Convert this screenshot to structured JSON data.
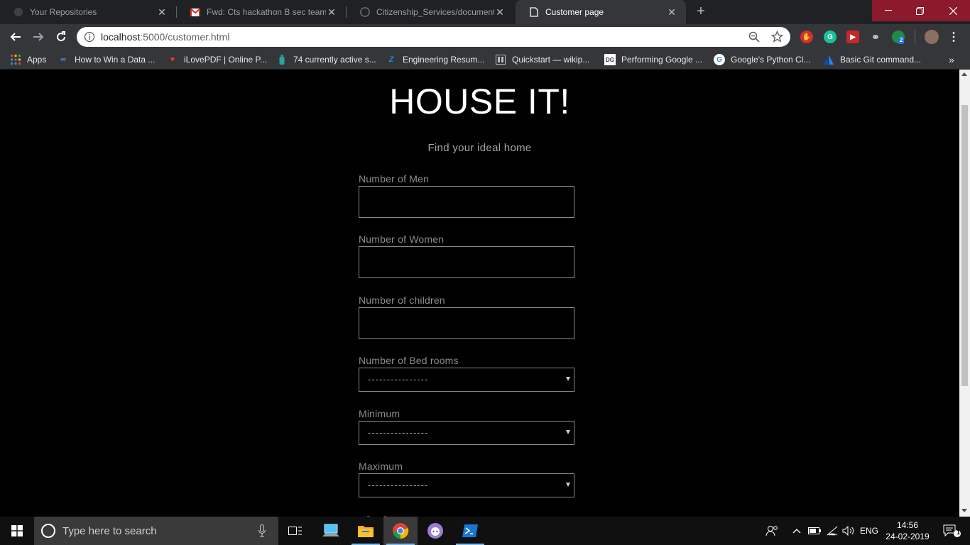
{
  "browser": {
    "tabs": [
      {
        "title": "Your Repositories",
        "icon": "github-icon"
      },
      {
        "title": "Fwd: Cts hackathon B sec team#...",
        "icon": "gmail-icon"
      },
      {
        "title": "Citizenship_Services/documentat...",
        "icon": "github-icon"
      },
      {
        "title": "Customer page",
        "icon": "page-icon"
      }
    ],
    "url_host": "localhost",
    "url_path": ":5000/customer.html",
    "extension_badge": "2",
    "bookmarks": [
      {
        "label": "Apps",
        "icon": "apps-grid-icon"
      },
      {
        "label": "How to Win a Data ...",
        "icon": "coursera-icon"
      },
      {
        "label": "iLovePDF | Online P...",
        "icon": "ilovepdf-icon"
      },
      {
        "label": "74 currently active s...",
        "icon": "bottle-icon"
      },
      {
        "label": "Engineering Resum...",
        "icon": "zety-icon"
      },
      {
        "label": "Quickstart — wikip...",
        "icon": "docs-icon"
      },
      {
        "label": "Performing Google ...",
        "icon": "dg-icon"
      },
      {
        "label": "Google's Python Cl...",
        "icon": "google-icon"
      },
      {
        "label": "Basic Git command...",
        "icon": "atlassian-icon"
      }
    ]
  },
  "page": {
    "title": "HOUSE IT!",
    "subtitle": "Find your ideal home",
    "fields": {
      "men_label": "Number of Men",
      "women_label": "Number of Women",
      "children_label": "Number of children",
      "bedrooms_label": "Number of Bed rooms",
      "bedrooms_value": "----------------",
      "minimum_label": "Minimum",
      "minimum_value": "----------------",
      "maximum_label": "Maximum",
      "maximum_value": "----------------"
    }
  },
  "taskbar": {
    "search_placeholder": "Type here to search",
    "language": "ENG",
    "time": "14:56",
    "date": "24-02-2019",
    "notification_count": "1"
  }
}
